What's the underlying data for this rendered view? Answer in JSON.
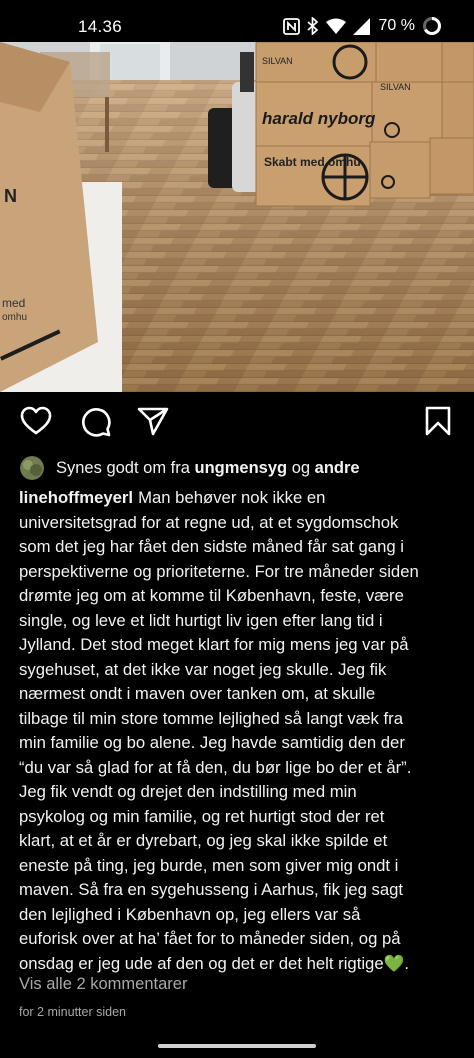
{
  "status_bar": {
    "time": "14.36",
    "battery": "70 %",
    "icons": [
      "nfc-icon",
      "bluetooth-icon",
      "wifi-icon",
      "signal-icon",
      "battery-icon"
    ]
  },
  "post": {
    "photo_box_texts": [
      "harald nyborg",
      "SILVAN",
      "Skabt med omhu"
    ],
    "actions": [
      "heart-icon",
      "comment-icon",
      "share-icon",
      "bookmark-icon"
    ],
    "likes": {
      "prefix": "Synes godt om fra ",
      "user": "ungmensyg",
      "middle": " og ",
      "others": "andre"
    },
    "caption": {
      "username": "linehoffmeyerl",
      "lines": [
        "Man behøver nok ikke en",
        "universitetsgrad for at regne ud, at et sygdomschok",
        "som det jeg har fået den sidste måned får sat gang i",
        "perspektiverne og prioriteterne. For tre måneder siden",
        "drømte jeg om at komme til København, feste, være",
        "single, og leve et lidt hurtigt liv igen efter lang tid i",
        "Jylland. Det stod meget klart for mig mens jeg var på",
        "sygehuset, at det ikke var noget jeg skulle. Jeg fik",
        "nærmest ondt i maven over tanken om, at skulle",
        "tilbage til min store tomme lejlighed så langt væk fra",
        "min familie og bo alene. Jeg havde samtidig den der",
        "“du var så glad for at få den, du bør lige bo der et år”.",
        "Jeg fik vendt og drejet den indstilling med min",
        "psykolog og min familie, og ret hurtigt stod der ret",
        "klart, at et år er dyrebart, og jeg skal ikke spilde et",
        "eneste på ting, jeg burde, men som giver mig ondt i",
        "maven. Så fra en sygehusseng i Aarhus, fik jeg sagt",
        "den lejlighed i København op, jeg ellers var så",
        "euforisk over at ha’ fået for to måneder siden, og på",
        "onsdag er jeg ude af den og det er det helt rigtige💚."
      ]
    },
    "view_comments": "Vis alle 2 kommentarer",
    "timestamp": "for 2 minutter siden"
  },
  "colors": {
    "background": "#000000",
    "text": "#f2f2f2",
    "muted": "#a8a8a8",
    "floor": "#b58a5a"
  }
}
